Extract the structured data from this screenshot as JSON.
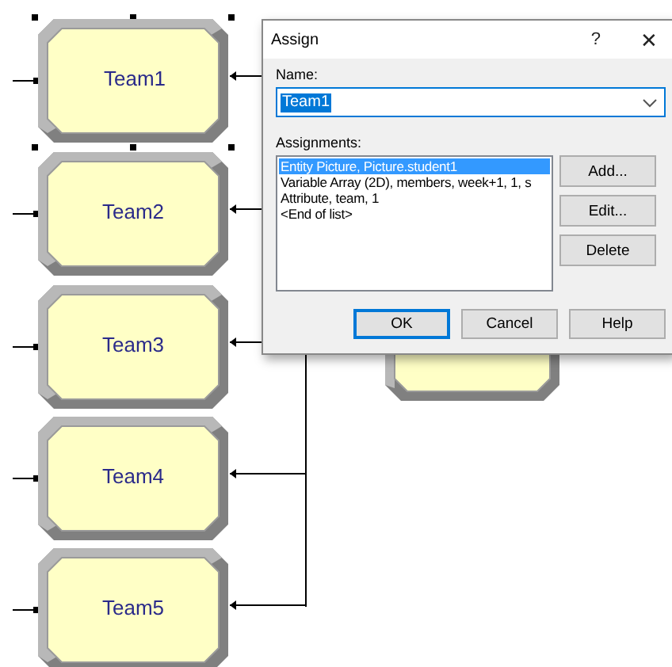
{
  "modules": [
    {
      "label": "Team1",
      "selected": true
    },
    {
      "label": "Team2",
      "selected": false
    },
    {
      "label": "Team3",
      "selected": false
    },
    {
      "label": "Team4",
      "selected": false
    },
    {
      "label": "Team5",
      "selected": false
    }
  ],
  "dialog": {
    "title": "Assign",
    "help_glyph": "?",
    "close_glyph": "✕",
    "name_label": "Name:",
    "name_value": "Team1",
    "assignments_label": "Assignments:",
    "assignments": [
      {
        "text": "Entity Picture, Picture.student1",
        "selected": true
      },
      {
        "text": "Variable Array (2D), members, week+1, 1, s",
        "selected": false
      },
      {
        "text": "Attribute, team, 1",
        "selected": false
      },
      {
        "text": "<End of list>",
        "selected": false
      }
    ],
    "side_buttons": [
      "Add...",
      "Edit...",
      "Delete"
    ],
    "bottom_buttons": [
      {
        "label": "OK",
        "default": true
      },
      {
        "label": "Cancel",
        "default": false
      },
      {
        "label": "Help",
        "default": false
      }
    ]
  }
}
